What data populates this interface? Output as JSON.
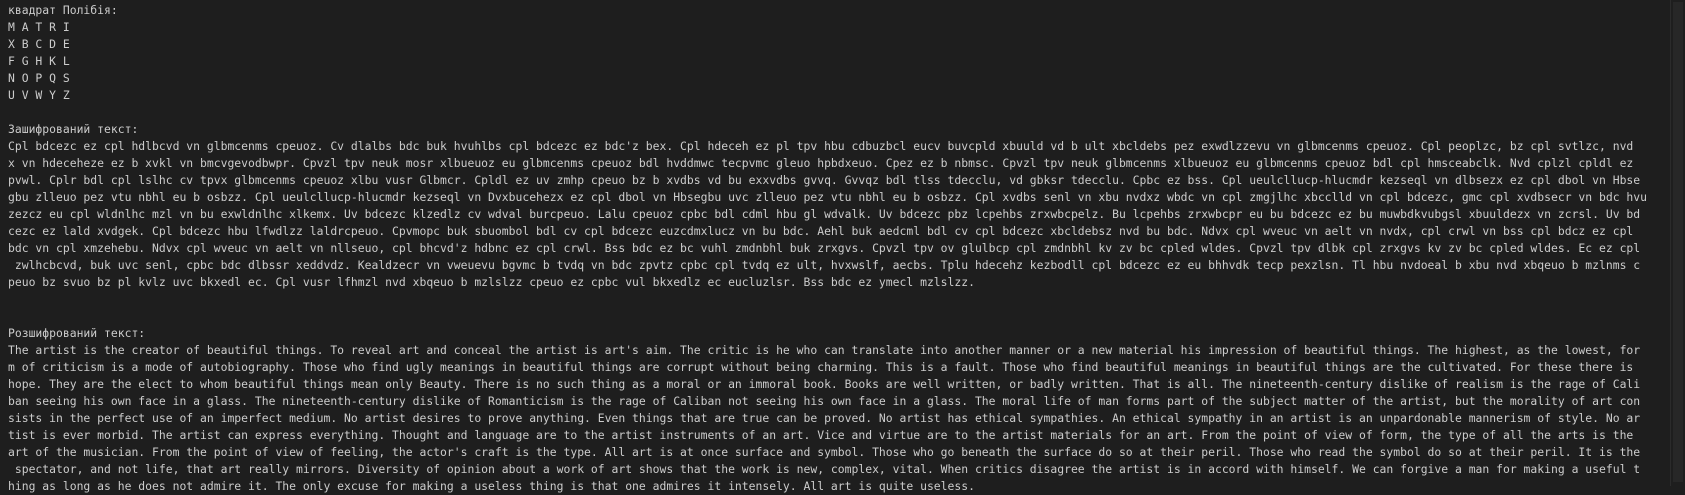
{
  "polybius": {
    "heading": "квадрат Полібія:",
    "rows": [
      "M A T R I",
      "X B C D E",
      "F G H K L",
      "N O P Q S",
      "U V W Y Z"
    ]
  },
  "encrypted": {
    "heading": "Зашифрований текст:",
    "lines": [
      "Cpl bdcezc ez cpl hdlbcvd vn glbmcenms cpeuoz. Cv dlalbs bdc buk hvuhlbs cpl bdcezc ez bdc'z bex. Cpl hdeceh ez pl tpv hbu cdbuzbcl eucv buvcpld xbuuld vd b ult xbcldebs pez exwdlzzevu vn glbmcenms cpeuoz. Cpl peoplzc, bz cpl svtlzc, nvd",
      "x vn hdeceheze ez b xvkl vn bmcvgevodbwpr. Cpvzl tpv neuk mosr xlbueuoz eu glbmcenms cpeuoz bdl hvddmwc tecpvmc gleuo hpbdxeuo. Cpez ez b nbmsc. Cpvzl tpv neuk glbmcenms xlbueuoz eu glbmcenms cpeuoz bdl cpl hmsceabclk. Nvd cplzl cpldl ez",
      "pvwl. Cplr bdl cpl lslhc cv tpvx glbmcenms cpeuoz xlbu vusr Glbmcr. Cpldl ez uv zmhp cpeuo bz b xvdbs vd bu exxvdbs gvvq. Gvvqz bdl tlss tdecclu, vd gbksr tdecclu. Cpbc ez bss. Cpl ueulcllucp-hlucmdr kezseql vn dlbsezx ez cpl dbol vn Hbse",
      "gbu zlleuo pez vtu nbhl eu b osbzz. Cpl ueulcllucp-hlucmdr kezseql vn Dvxbucehezx ez cpl dbol vn Hbsegbu uvc zlleuo pez vtu nbhl eu b osbzz. Cpl xvdbs senl vn xbu nvdxz wbdc vn cpl zmgjlhc xbcclld vn cpl bdcezc, gmc cpl xvdbsecr vn bdc hvu",
      "zezcz eu cpl wldnlhc mzl vn bu exwldnlhc xlkemx. Uv bdcezc klzedlz cv wdval burcpeuo. Lalu cpeuoz cpbc bdl cdml hbu gl wdvalk. Uv bdcezc pbz lcpehbs zrxwbcpelz. Bu lcpehbs zrxwbcpr eu bu bdcezc ez bu muwbdkvubgsl xbuuldezx vn zcrsl. Uv bd",
      "cezc ez lald xvdgek. Cpl bdcezc hbu lfwdlzz laldrcpeuo. Cpvmopc buk sbuombol bdl cv cpl bdcezc euzcdmxlucz vn bu bdc. Aehl buk aedcml bdl cv cpl bdcezc xbcldebsz nvd bu bdc. Ndvx cpl wveuc vn aelt vn nvdx, cpl crwl vn bss cpl bdcz ez cpl",
      "bdc vn cpl xmzehebu. Ndvx cpl wveuc vn aelt vn nllseuo, cpl bhcvd'z hdbnc ez cpl crwl. Bss bdc ez bc vuhl zmdnbhl buk zrxgvs. Cpvzl tpv ov glulbcp cpl zmdnbhl kv zv bc cpled wldes. Cpvzl tpv dlbk cpl zrxgvs kv zv bc cpled wldes. Ec ez cpl",
      " zwlhcbcvd, buk uvc senl, cpbc bdc dlbssr xeddvdz. Kealdzecr vn vweuevu bgvmc b tvdq vn bdc zpvtz cpbc cpl tvdq ez ult, hvxwslf, aecbs. Tplu hdecehz kezbodll cpl bdcezc ez eu bhhvdk tecp pexzlsn. Tl hbu nvdoeal b xbu nvd xbqeuo b mzlnms c",
      "peuo bz svuo bz pl kvlz uvc bkxedl ec. Cpl vusr lfhmzl nvd xbqeuo b mzlslzz cpeuo ez cpbc vul bkxedlz ec eucluzlsr. Bss bdc ez ymecl mzlslzz."
    ]
  },
  "decrypted": {
    "heading": "Розшифрований текст:",
    "lines": [
      "The artist is the creator of beautiful things. To reveal art and conceal the artist is art's aim. The critic is he who can translate into another manner or a new material his impression of beautiful things. The highest, as the lowest, for",
      "m of criticism is a mode of autobiography. Those who find ugly meanings in beautiful things are corrupt without being charming. This is a fault. Those who find beautiful meanings in beautiful things are the cultivated. For these there is",
      "hope. They are the elect to whom beautiful things mean only Beauty. There is no such thing as a moral or an immoral book. Books are well written, or badly written. That is all. The nineteenth-century dislike of realism is the rage of Cali",
      "ban seeing his own face in a glass. The nineteenth-century dislike of Romanticism is the rage of Caliban not seeing his own face in a glass. The moral life of man forms part of the subject matter of the artist, but the morality of art con",
      "sists in the perfect use of an imperfect medium. No artist desires to prove anything. Even things that are true can be proved. No artist has ethical sympathies. An ethical sympathy in an artist is an unpardonable mannerism of style. No ar",
      "tist is ever morbid. The artist can express everything. Thought and language are to the artist instruments of an art. Vice and virtue are to the artist materials for an art. From the point of view of form, the type of all the arts is the",
      "art of the musician. From the point of view of feeling, the actor's craft is the type. All art is at once surface and symbol. Those who go beneath the surface do so at their peril. Those who read the symbol do so at their peril. It is the",
      " spectator, and not life, that art really mirrors. Diversity of opinion about a work of art shows that the work is new, complex, vital. When critics disagree the artist is in accord with himself. We can forgive a man for making a useful t",
      "hing as long as he does not admire it. The only excuse for making a useless thing is that one admires it intensely. All art is quite useless."
    ]
  }
}
